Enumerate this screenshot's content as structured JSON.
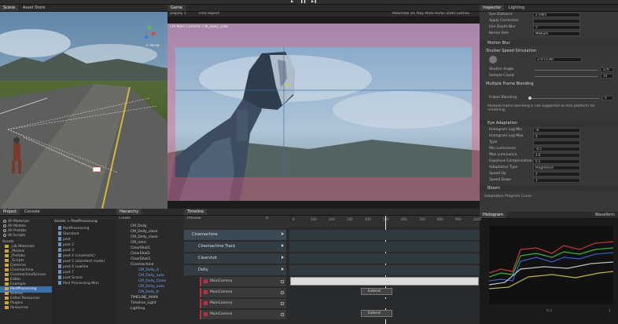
{
  "top_toolbar": {
    "play": "▶",
    "pause": "❚❚",
    "step": "▶❚"
  },
  "scene_panel": {
    "tab_scene": "Scene",
    "tab_asset": "Asset Store",
    "persp_label": "< Persp"
  },
  "game_panel": {
    "tab": "Game",
    "display": "Display 1",
    "aspect": "Free Aspect",
    "toolbar_right": "Maximize On Play  Mute Audio  Stats  Gizmos",
    "camera_label": "CM Main Camera: CM_Dolly_auto"
  },
  "inspector": {
    "tab_inspector": "Inspector",
    "tab_lighting": "Lighting",
    "top_rows": [
      {
        "label": "Sun Distance",
        "value": "2.5965"
      },
      {
        "label": "Apply Correction",
        "value": ""
      },
      {
        "label": "Use Depth Blur",
        "value": "✔"
      },
      {
        "label": "Kernel Size",
        "value": "Medium"
      }
    ],
    "motion_blur_header": "Motion Blur",
    "shutter_speed_header": "Shutter Speed Simulation",
    "shutter_angle_value": "270 (1/30)",
    "shutter_rows": [
      {
        "label": "Shutter Angle",
        "value": "270"
      },
      {
        "label": "Sample Count",
        "value": "10"
      }
    ],
    "frame_blend_header": "Multiple Frame Blending",
    "frame_blending_label": "Frame Blending",
    "frame_blending_value": "0",
    "frame_blend_note": "Multiple frame blending is not supported on this platform for rendering.",
    "eye_adaptation_header": "Eye Adaptation",
    "eye_rows": [
      {
        "label": "Histogram Log Min",
        "value": "-8"
      },
      {
        "label": "Histogram Log Max",
        "value": "4"
      },
      {
        "label": "Type",
        "value": ""
      },
      {
        "label": "Min Luminance",
        "value": "-0.5"
      },
      {
        "label": "Max Luminance",
        "value": "2.6"
      },
      {
        "label": "Exposure Compensation",
        "value": "0.5"
      },
      {
        "label": "Adaptation Type",
        "value": "Progressive"
      },
      {
        "label": "Speed Up",
        "value": "2"
      },
      {
        "label": "Speed Down",
        "value": "1"
      }
    ],
    "bloom_header": "Bloom",
    "preview_label": "Adaptation Progress Curve"
  },
  "histogram_panel": {
    "tab_histogram": "Histogram",
    "tab_waveform": "Waveform",
    "bottom_labels": [
      "0.5",
      "1"
    ]
  },
  "project_panel": {
    "tab_project": "Project",
    "tab_console": "Console",
    "favorites": [
      "All Materials",
      "All Models",
      "All Prefabs",
      "All Scripts"
    ],
    "assets_header": "Assets",
    "folders": [
      "_Lib Materials",
      "_Models",
      "_Prefabs",
      "_Scripts",
      "Cameras",
      "Cinemachine",
      "CinemachineScenes",
      "Editor",
      "Example",
      "PostProcessing",
      "Scenes",
      "Editor Resources",
      "Plugins",
      "Resources"
    ],
    "breadcrumb": "Assets > PostProcessing",
    "files": [
      "PostProcessing",
      "Standard",
      "post",
      "post 2",
      "post 3",
      "post 4 (cinematic)",
      "post 5 (standard mode)",
      "post 6 Lowline",
      "post 7",
      "post Scene",
      "Post Processing Mon"
    ]
  },
  "hierarchy_panel": {
    "tab": "Hierarchy",
    "create_label": "Create",
    "items": [
      "CM_Dolly",
      "CM_Dolly_close",
      "CM_Dolly_close",
      "CM_Intro",
      "ClearShot1",
      "ClearShot2",
      "ClearShot3",
      "Cinemachine",
      "CM_Dolly_A",
      "CM_Dolly_auto",
      "CM_Dolly_Close",
      "CM_Dolly_auto",
      "CM_Dolly_B",
      "TIMELINE_MAIN",
      "Timeline_Light",
      "Lighting"
    ]
  },
  "timeline_panel": {
    "tab": "Timeline",
    "preview": "Preview",
    "frame": "0",
    "tracks": [
      {
        "name": "Cinemachine"
      },
      {
        "name": "Cinemachine Track"
      },
      {
        "name": "Clearshot"
      },
      {
        "name": "Dolly"
      }
    ],
    "shot_tracks": [
      "MainCamera",
      "MainCamera",
      "MainCamera",
      "MainCamera"
    ],
    "clip_label": "Extend",
    "ruler": [
      "0",
      "100",
      "200",
      "300",
      "400",
      "500",
      "600",
      "700",
      "800",
      "900",
      "1000"
    ]
  },
  "colors": {
    "accent_blue": "#3d6fa8",
    "overlay_pink": "#c25a86",
    "track_red": "#b3323f",
    "track_green": "#4caf50"
  }
}
